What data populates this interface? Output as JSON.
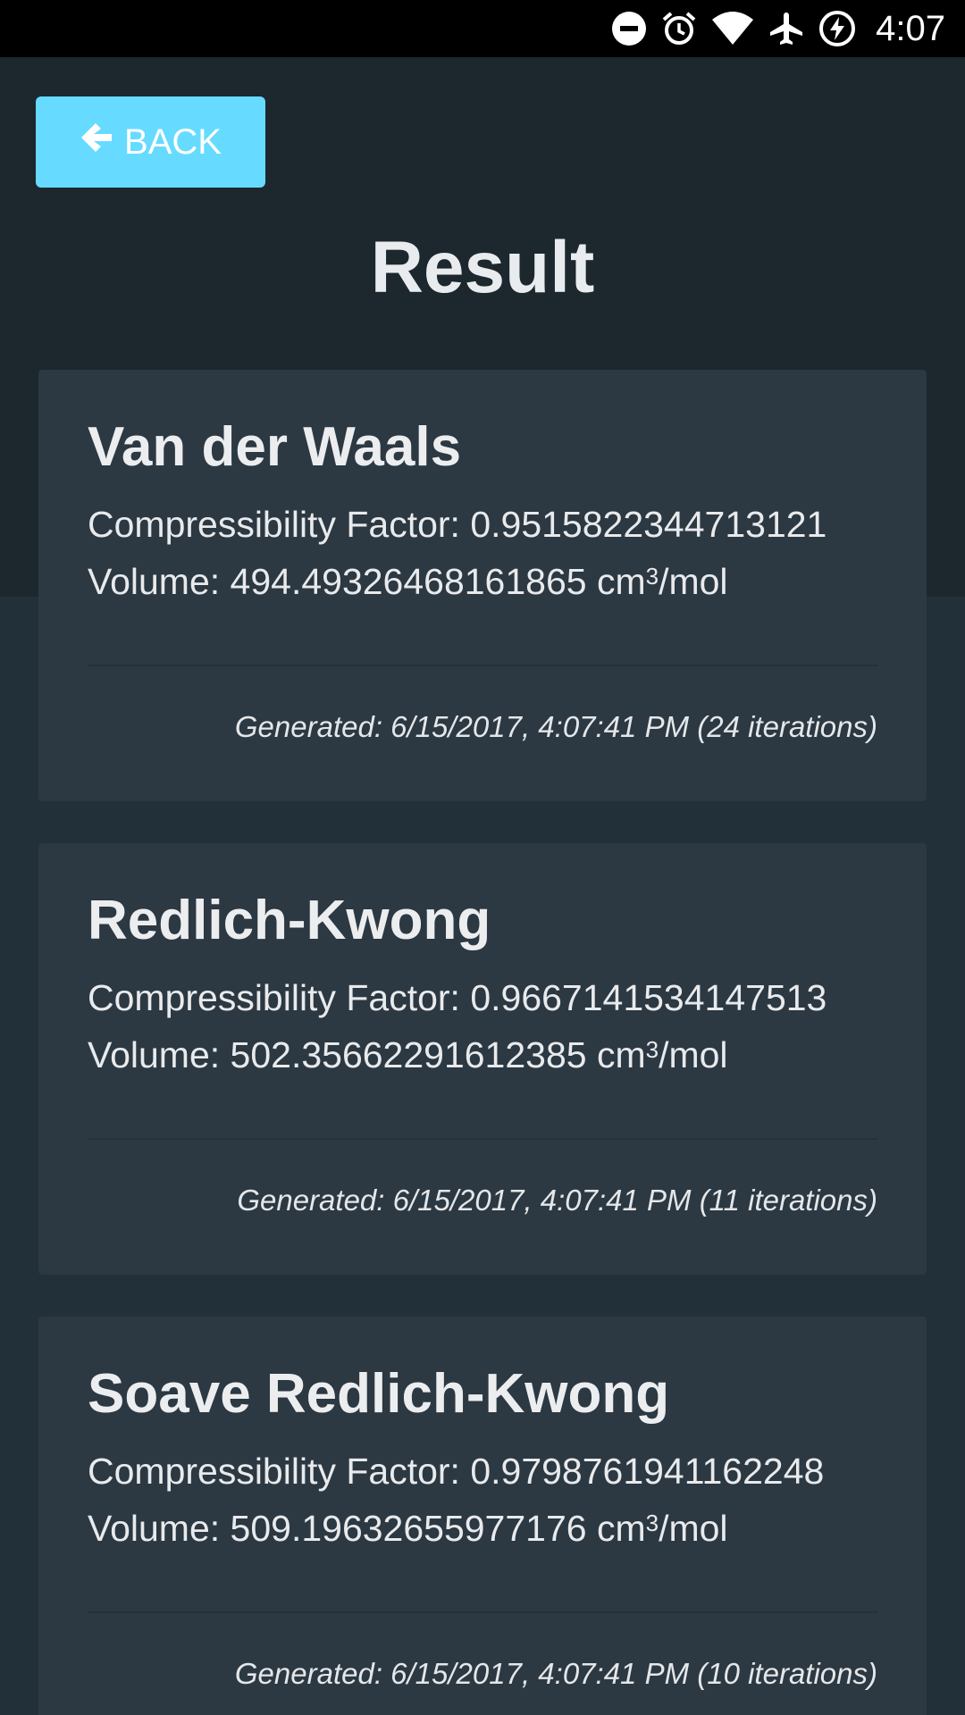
{
  "status_bar": {
    "time": "4:07",
    "icons": [
      "do-not-disturb-icon",
      "alarm-icon",
      "wifi-icon",
      "airplane-icon",
      "battery-charging-icon"
    ]
  },
  "header": {
    "back_label": "BACK",
    "back_icon": "arrow-left-icon",
    "title": "Result"
  },
  "results": [
    {
      "name": "Van der Waals",
      "factor_text": "Compressibility Factor: 0.9515822344713121",
      "volume_prefix": "Volume: 494.49326468161865 cm",
      "volume_exp": "3",
      "volume_suffix": "/mol",
      "generated": "Generated: 6/15/2017, 4:07:41 PM (24 iterations)"
    },
    {
      "name": "Redlich-Kwong",
      "factor_text": "Compressibility Factor: 0.9667141534147513",
      "volume_prefix": "Volume: 502.35662291612385 cm",
      "volume_exp": "3",
      "volume_suffix": "/mol",
      "generated": "Generated: 6/15/2017, 4:07:41 PM (11 iterations)"
    },
    {
      "name": "Soave Redlich-Kwong",
      "factor_text": "Compressibility Factor: 0.9798761941162248",
      "volume_prefix": "Volume: 509.19632655977176 cm",
      "volume_exp": "3",
      "volume_suffix": "/mol",
      "generated": "Generated: 6/15/2017, 4:07:41 PM (10 iterations)"
    }
  ],
  "colors": {
    "accent": "#66dbff",
    "background": "#223039",
    "header_background": "#1c272e",
    "card": "#2c3842"
  }
}
